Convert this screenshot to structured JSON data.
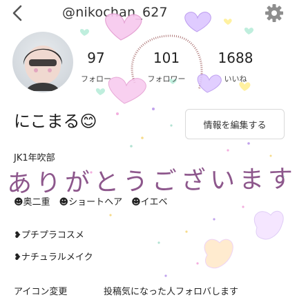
{
  "header": {
    "username": "@nikochan_627"
  },
  "profile": {
    "display_name": "にこまる",
    "name_emoji": "😊",
    "edit_button_label": "情報を編集する"
  },
  "stats": [
    {
      "value": "97",
      "label": "フォロー"
    },
    {
      "value": "101",
      "label": "フォロワー"
    },
    {
      "value": "1688",
      "label": "いいね"
    }
  ],
  "bio": {
    "line1": "JK1年吹部",
    "overlay_text": "ありがとうございます",
    "line2": "☻奥二重　☻ショートヘア　☻イエベ",
    "line3": "❥プチプラコスメ",
    "line4": "❥ナチュラルメイク"
  },
  "footer": {
    "left": "アイコン変更",
    "right": "投稿気になった人フォロバします"
  },
  "colors": {
    "heart_pink": "#f7b8e6",
    "heart_mint": "#c9f2e4",
    "heart_purple": "#d8b8ff",
    "heart_yellow": "#fff3a8",
    "text_overlay": "#7a3a78"
  }
}
